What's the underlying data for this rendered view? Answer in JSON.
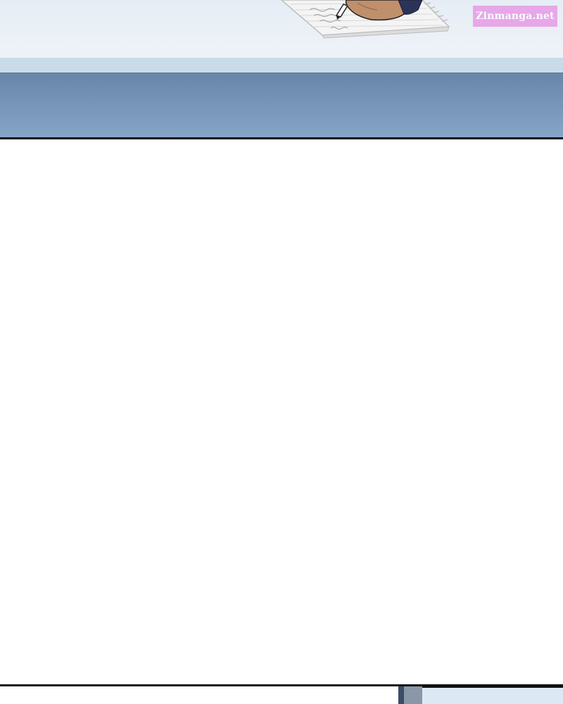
{
  "watermark": {
    "text": "Zinmanga.net",
    "color": "#e79be6"
  },
  "colors": {
    "sky_light": "#e9eff6",
    "sky_band": "#c8dbea",
    "sea_top": "#6885a8",
    "sea_bottom": "#84a3c6",
    "skin": "#c08f6c",
    "sleeve": "#2c3358",
    "border": "#111111"
  }
}
